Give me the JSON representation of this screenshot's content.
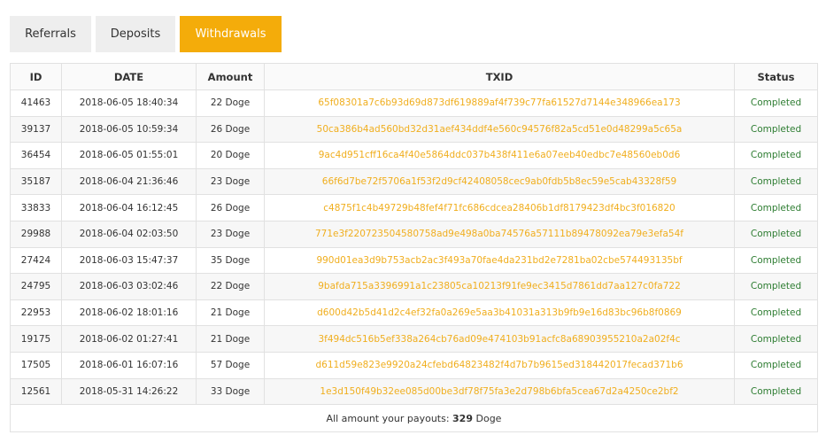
{
  "tabs": [
    {
      "label": "Referrals",
      "active": false
    },
    {
      "label": "Deposits",
      "active": false
    },
    {
      "label": "Withdrawals",
      "active": true
    }
  ],
  "colors": {
    "accent": "#f4ac0a",
    "txid": "#f0ae1e",
    "status_completed": "#2e7d32"
  },
  "table": {
    "headers": [
      "ID",
      "DATE",
      "Amount",
      "TXID",
      "Status"
    ],
    "rows": [
      {
        "id": "41463",
        "date": "2018-06-05 18:40:34",
        "amount": "22 Doge",
        "txid": "65f08301a7c6b93d69d873df619889af4f739c77fa61527d7144e348966ea173",
        "status": "Completed"
      },
      {
        "id": "39137",
        "date": "2018-06-05 10:59:34",
        "amount": "26 Doge",
        "txid": "50ca386b4ad560bd32d31aef434ddf4e560c94576f82a5cd51e0d48299a5c65a",
        "status": "Completed"
      },
      {
        "id": "36454",
        "date": "2018-06-05 01:55:01",
        "amount": "20 Doge",
        "txid": "9ac4d951cff16ca4f40e5864ddc037b438f411e6a07eeb40edbc7e48560eb0d6",
        "status": "Completed"
      },
      {
        "id": "35187",
        "date": "2018-06-04 21:36:46",
        "amount": "23 Doge",
        "txid": "66f6d7be72f5706a1f53f2d9cf42408058cec9ab0fdb5b8ec59e5cab43328f59",
        "status": "Completed"
      },
      {
        "id": "33833",
        "date": "2018-06-04 16:12:45",
        "amount": "26 Doge",
        "txid": "c4875f1c4b49729b48fef4f71fc686cdcea28406b1df8179423df4bc3f016820",
        "status": "Completed"
      },
      {
        "id": "29988",
        "date": "2018-06-04 02:03:50",
        "amount": "23 Doge",
        "txid": "771e3f220723504580758ad9e498a0ba74576a57111b89478092ea79e3efa54f",
        "status": "Completed"
      },
      {
        "id": "27424",
        "date": "2018-06-03 15:47:37",
        "amount": "35 Doge",
        "txid": "990d01ea3d9b753acb2ac3f493a70fae4da231bd2e7281ba02cbe574493135bf",
        "status": "Completed"
      },
      {
        "id": "24795",
        "date": "2018-06-03 03:02:46",
        "amount": "22 Doge",
        "txid": "9bafda715a3396991a1c23805ca10213f91fe9ec3415d7861dd7aa127c0fa722",
        "status": "Completed"
      },
      {
        "id": "22953",
        "date": "2018-06-02 18:01:16",
        "amount": "21 Doge",
        "txid": "d600d42b5d41d2c4ef32fa0a269e5aa3b41031a313b9fb9e16d83bc96b8f0869",
        "status": "Completed"
      },
      {
        "id": "19175",
        "date": "2018-06-02 01:27:41",
        "amount": "21 Doge",
        "txid": "3f494dc516b5ef338a264cb76ad09e474103b91acfc8a68903955210a2a02f4c",
        "status": "Completed"
      },
      {
        "id": "17505",
        "date": "2018-06-01 16:07:16",
        "amount": "57 Doge",
        "txid": "d611d59e823e9920a24cfebd64823482f4d7b7b9615ed318442017fecad371b6",
        "status": "Completed"
      },
      {
        "id": "12561",
        "date": "2018-05-31 14:26:22",
        "amount": "33 Doge",
        "txid": "1e3d150f49b32ee085d00be3df78f75fa3e2d798b6bfa5cea67d2a4250ce2bf2",
        "status": "Completed"
      }
    ]
  },
  "footer": {
    "prefix": "All amount your payouts: ",
    "total": "329",
    "suffix": " Doge"
  }
}
